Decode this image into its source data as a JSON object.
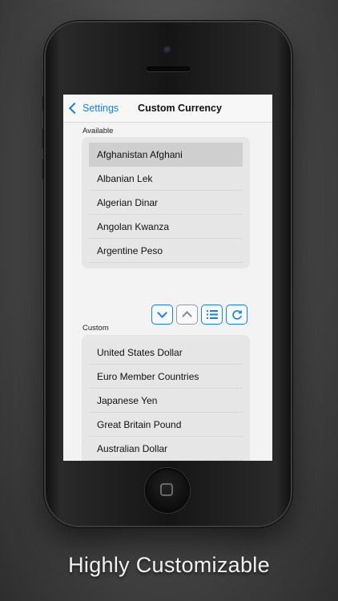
{
  "nav": {
    "back_label": "Settings",
    "title": "Custom Currency"
  },
  "available": {
    "label": "Available",
    "items": [
      "Afghanistan Afghani",
      "Albanian Lek",
      "Algerian Dinar",
      "Angolan Kwanza",
      "Argentine Peso"
    ],
    "selected_index": 0
  },
  "custom": {
    "label": "Custom",
    "items": [
      "United States Dollar",
      "Euro Member Countries",
      "Japanese Yen",
      "Great Britain Pound",
      "Australian Dollar"
    ]
  },
  "toolbar": {
    "buttons": [
      {
        "icon": "chevron-down-icon",
        "enabled": true
      },
      {
        "icon": "chevron-up-icon",
        "enabled": false
      },
      {
        "icon": "list-icon",
        "enabled": true
      },
      {
        "icon": "refresh-icon",
        "enabled": true
      }
    ]
  },
  "colors": {
    "accent": "#1a7fe0",
    "selected_row": "#cfcfcf",
    "group_bg": "#e6e6e6"
  },
  "caption": "Highly Customizable"
}
